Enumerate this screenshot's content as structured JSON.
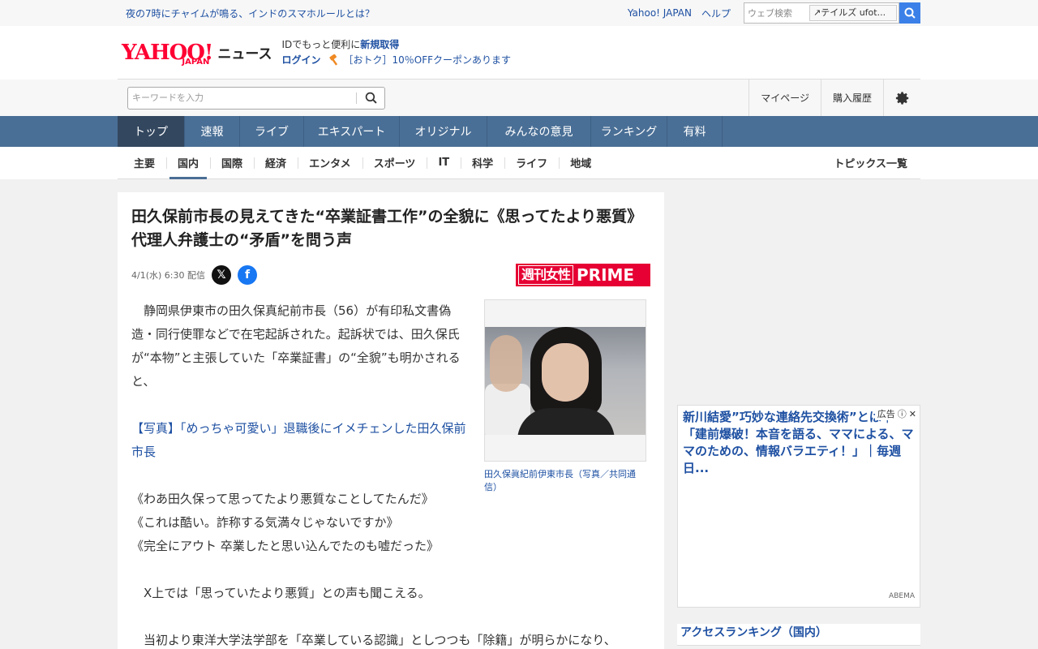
{
  "topbar": {
    "headline_link": "夜の7時にチャイムが鳴る、インドのスマホルールとは？",
    "yahoo_japan": "Yahoo! JAPAN",
    "help": "ヘルプ",
    "web_search_placeholder": "ウェブ検索",
    "web_search_tag": "テイルズ ufot..."
  },
  "logo": {
    "yahoo": "YAHOO!",
    "japan": "JAPAN",
    "news": "ニュース"
  },
  "login": {
    "line1_prefix": "IDでもっと便利に",
    "line1_link": "新規取得",
    "login_label": "ログイン",
    "coupon": "［おトク］10％OFFクーポンあります"
  },
  "search": {
    "placeholder": "キーワードを入力"
  },
  "mymenu": {
    "mypage": "マイページ",
    "history": "購入履歴"
  },
  "mainnav": [
    "トップ",
    "速報",
    "ライブ",
    "エキスパート",
    "オリジナル",
    "みんなの意見",
    "ランキング",
    "有料"
  ],
  "subnav": [
    "主要",
    "国内",
    "国際",
    "経済",
    "エンタメ",
    "スポーツ",
    "IT",
    "科学",
    "ライフ",
    "地域"
  ],
  "subnav_topics": "トピックス一覧",
  "article": {
    "headline": "田久保前市長の見えてきた“卒業証書工作”の全貌に《思ってたより悪質》代理人弁護士の“矛盾”を問う声",
    "date": "4/1(水) 6:30 配信",
    "source_jp": "週刊女性",
    "source_en": "PRIME",
    "paragraphs": [
      "　静岡県伊東市の田久保真紀前市長（56）が有印私文書偽造・同行使罪などで在宅起訴された。起訴状では、田久保氏が“本物”と主張していた「卒業証書」の“全貌”も明かされると、",
      "【写真】「めっちゃ可愛い」退職後にイメチェンした田久保前市長",
      "《わあ田久保って思ってたより悪質なことしてたんだ》",
      "《これは酷い。詐称する気満々じゃないですか》",
      "《完全にアウト 卒業したと思い込んでたのも嘘だった》",
      "　X上では「思っていたより悪質」との声も聞こえる。",
      "　当初より東洋大学法学部を「卒業している認識」としつつも「除籍」が明らかになり、"
    ],
    "photo_caption": "田久保眞紀前伊東市長（写真／共同通信）"
  },
  "sidebar": {
    "ad_title": "新川結愛”巧妙な連絡先交換術”とは｜「建前爆破！本音を語る、ママによる、ママのための、情報バラエティ！」｜毎週日...",
    "ad_label": "広告",
    "ad_source": "ABEMA",
    "ranking_title": "アクセスランキング（国内）"
  },
  "colors": {
    "nav_bg": "#4a6f96",
    "nav_active": "#33475f",
    "link": "#1e50a2",
    "brand_red": "#ff0033"
  }
}
